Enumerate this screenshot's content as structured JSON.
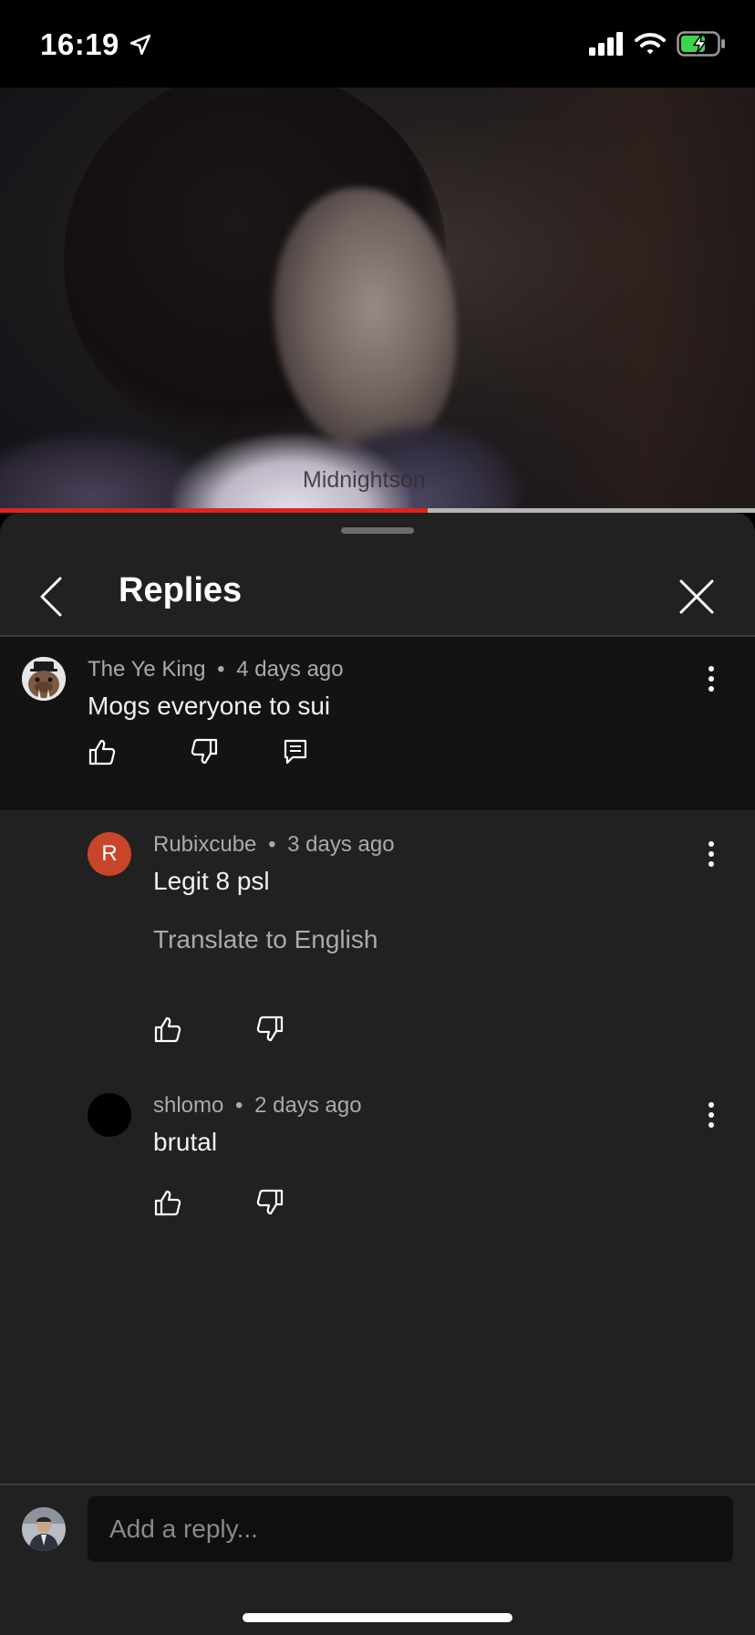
{
  "status_bar": {
    "time": "16:19",
    "icons": [
      "location-arrow-icon",
      "cellular-signal-icon",
      "wifi-icon",
      "battery-charging-icon"
    ]
  },
  "video": {
    "watermark": "Midnightson",
    "progress_fraction": 0.567,
    "progress_color": "#e0241c"
  },
  "sheet": {
    "title": "Replies",
    "back_icon": "chevron-left-icon",
    "close_icon": "close-icon"
  },
  "main_comment": {
    "author": "The Ye King",
    "age": "4 days ago",
    "text": "Mogs everyone to sui",
    "avatar_icon": "walrus-avatar"
  },
  "replies": [
    {
      "author": "Rubixcube",
      "age": "3 days ago",
      "text": "Legit 8 psl",
      "translate_label": "Translate to English",
      "avatar_letter": "R",
      "avatar_color": "#c9452a"
    },
    {
      "author": "shlomo",
      "age": "2 days ago",
      "text": "brutal",
      "avatar_color": "#000000"
    }
  ],
  "reply_bar": {
    "placeholder": "Add a reply..."
  },
  "separator": "•"
}
